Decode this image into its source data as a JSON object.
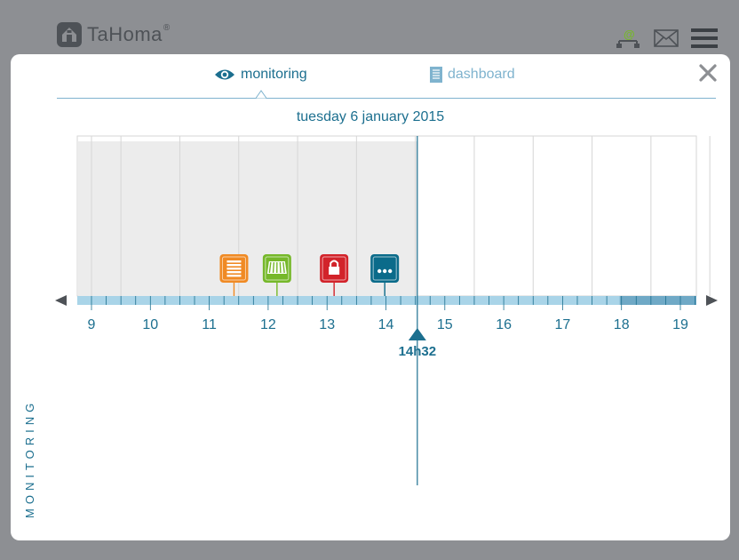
{
  "app": {
    "name": "TaHoma",
    "reg_mark": "®"
  },
  "topbar": {
    "icons": [
      "network-at-icon",
      "mail-icon",
      "menu-icon"
    ]
  },
  "tabs": [
    {
      "id": "monitoring",
      "label": "monitoring",
      "icon": "eye-icon",
      "active": true
    },
    {
      "id": "dashboard",
      "label": "dashboard",
      "icon": "document-icon",
      "active": false
    }
  ],
  "date_label": "tuesday 6 january 2015",
  "timeline": {
    "hours": [
      "9",
      "10",
      "11",
      "12",
      "13",
      "14",
      "15",
      "16",
      "17",
      "18",
      "19"
    ],
    "current_time_label": "14h32",
    "current_time_value": 14.533,
    "events": [
      {
        "type": "roller-shutter",
        "hour": 11.42,
        "color": "#f08a24"
      },
      {
        "type": "awning",
        "hour": 12.15,
        "color": "#76b82a"
      },
      {
        "type": "lock",
        "hour": 13.12,
        "color": "#d2232a"
      },
      {
        "type": "more",
        "hour": 13.98,
        "color": "#0b6b8a"
      }
    ]
  },
  "side_label": "MONITORING",
  "colors": {
    "accent": "#1c6f8f",
    "light_accent": "#7fb3ce",
    "past_shade": "#ececec",
    "track": "#a9d4e8"
  }
}
